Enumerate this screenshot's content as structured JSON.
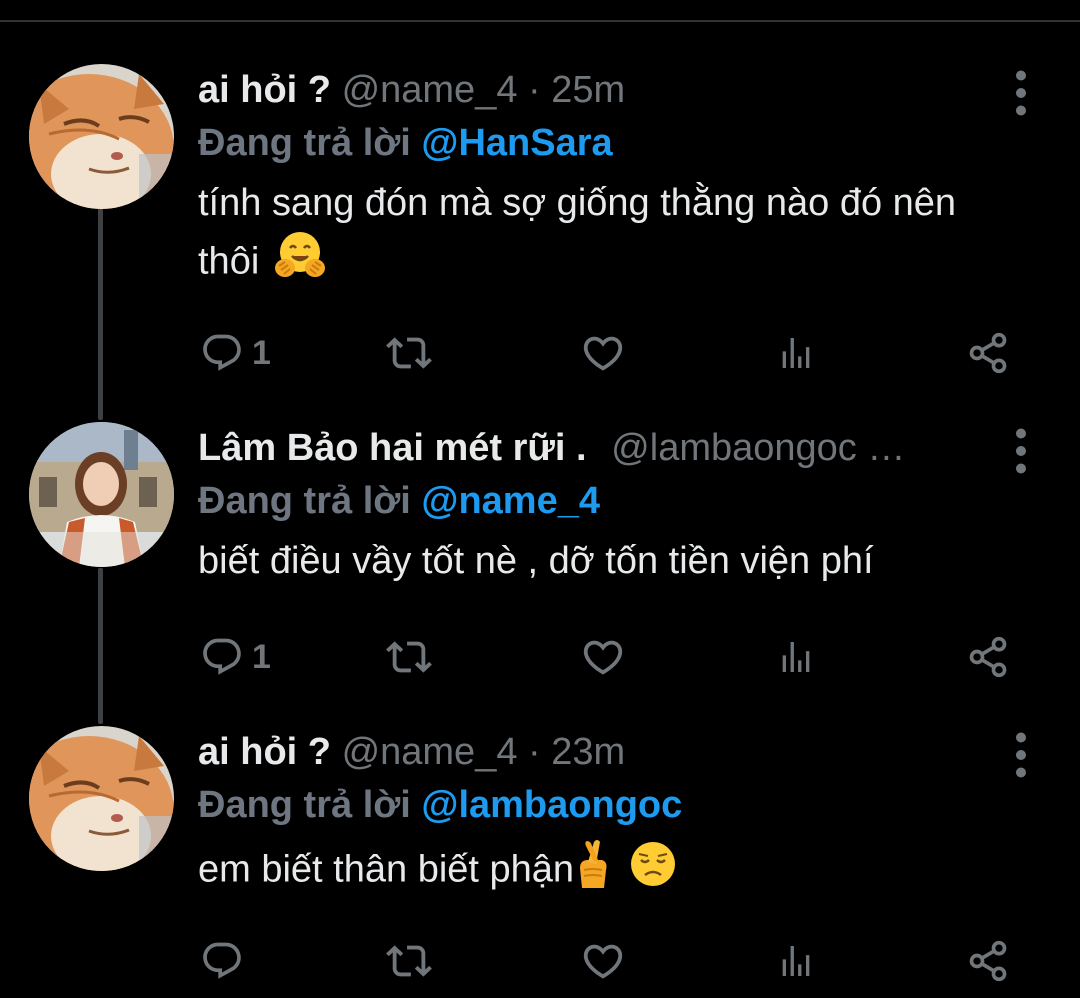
{
  "colors": {
    "background": "#000000",
    "name": "#e7e9ea",
    "muted": "#71767b",
    "mention": "#1d9bf0",
    "thread_line": "#3e4144"
  },
  "tweets": [
    {
      "avatar_icon": "orange-cat-avatar",
      "name": "ai hỏi ?",
      "handle": "@name_4",
      "dot": "·",
      "time": "25m",
      "reply_prefix": "Đang trả lời",
      "reply_to": "@HanSara",
      "text": "tính sang đón mà sợ giống thằng nào đó nên thôi",
      "emojis": [
        "hugging-face-emoji"
      ],
      "reply_count": "1",
      "retweet_count": "",
      "like_count": "",
      "views_count": ""
    },
    {
      "avatar_icon": "woman-photo-avatar",
      "name": "Lâm Bảo hai mét rữi .",
      "handle": "@lambaongoc …",
      "dot": "",
      "time": "",
      "reply_prefix": "Đang trả lời",
      "reply_to": "@name_4",
      "text": "biết điều vầy tốt nè , dỡ tốn tiền viện phí",
      "emojis": [],
      "reply_count": "1",
      "retweet_count": "",
      "like_count": "",
      "views_count": ""
    },
    {
      "avatar_icon": "orange-cat-avatar",
      "name": "ai hỏi ?",
      "handle": "@name_4",
      "dot": "·",
      "time": "23m",
      "reply_prefix": "Đang trả lời",
      "reply_to": "@lambaongoc",
      "text": "em biết thân biết phận",
      "emojis": [
        "crossed-fingers-emoji",
        "disappointed-face-emoji"
      ],
      "reply_count": "",
      "retweet_count": "",
      "like_count": "",
      "views_count": ""
    }
  ]
}
